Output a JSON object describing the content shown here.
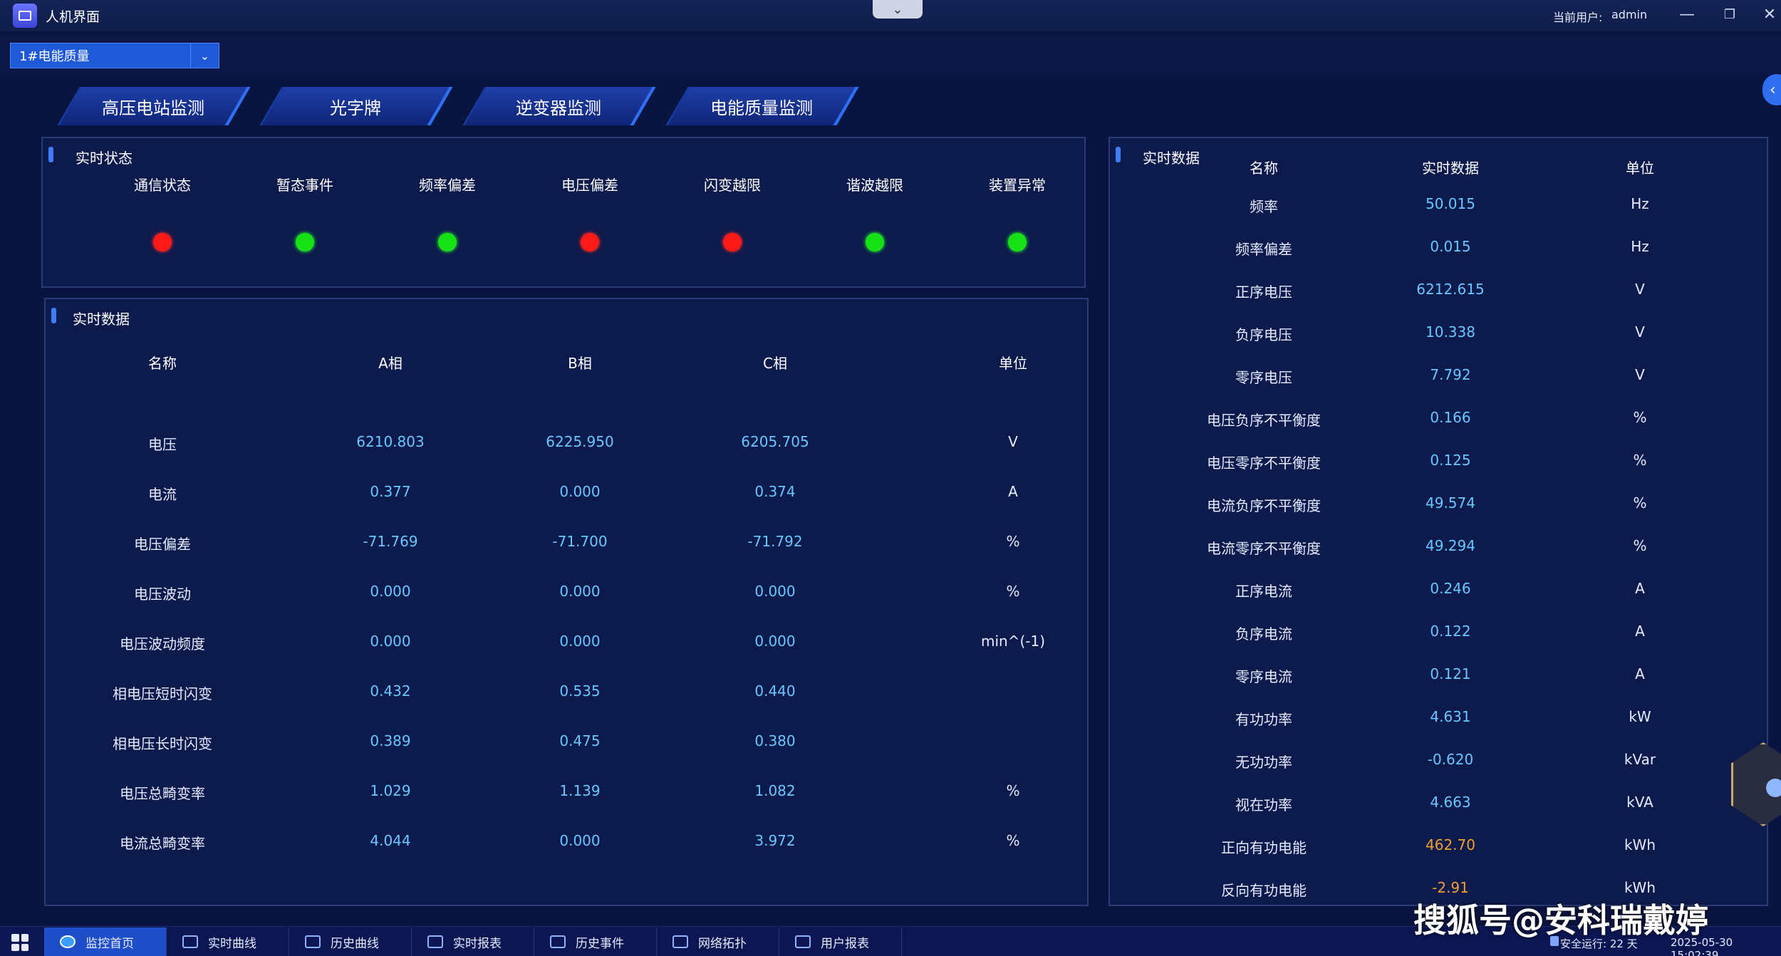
{
  "window": {
    "title": "人机界面",
    "current_user_label": "当前用户:",
    "current_user": "admin",
    "minimize": "—",
    "restore": "❐",
    "close": "✕"
  },
  "device_select": {
    "value": "1#电能质量"
  },
  "tabs": [
    "高压电站监测",
    "光字牌",
    "逆变器监测",
    "电能质量监测"
  ],
  "status_panel": {
    "title": "实时状态",
    "items": [
      {
        "label": "通信状态",
        "state": "red"
      },
      {
        "label": "暂态事件",
        "state": "green"
      },
      {
        "label": "频率偏差",
        "state": "green"
      },
      {
        "label": "电压偏差",
        "state": "red"
      },
      {
        "label": "闪变越限",
        "state": "red"
      },
      {
        "label": "谐波越限",
        "state": "green"
      },
      {
        "label": "装置异常",
        "state": "green"
      }
    ]
  },
  "phase_panel": {
    "title": "实时数据",
    "headers": [
      "名称",
      "A相",
      "B相",
      "C相",
      "单位"
    ],
    "rows": [
      [
        "电压",
        "6210.803",
        "6225.950",
        "6205.705",
        "V"
      ],
      [
        "电流",
        "0.377",
        "0.000",
        "0.374",
        "A"
      ],
      [
        "电压偏差",
        "-71.769",
        "-71.700",
        "-71.792",
        "%"
      ],
      [
        "电压波动",
        "0.000",
        "0.000",
        "0.000",
        "%"
      ],
      [
        "电压波动频度",
        "0.000",
        "0.000",
        "0.000",
        "min^(-1)"
      ],
      [
        "相电压短时闪变",
        "0.432",
        "0.535",
        "0.440",
        ""
      ],
      [
        "相电压长时闪变",
        "0.389",
        "0.475",
        "0.380",
        ""
      ],
      [
        "电压总畸变率",
        "1.029",
        "1.139",
        "1.082",
        "%"
      ],
      [
        "电流总畸变率",
        "4.044",
        "0.000",
        "3.972",
        "%"
      ]
    ]
  },
  "summary_panel": {
    "title": "实时数据",
    "headers": [
      "名称",
      "实时数据",
      "单位"
    ],
    "rows": [
      [
        "频率",
        "50.015",
        "Hz"
      ],
      [
        "频率偏差",
        "0.015",
        "Hz"
      ],
      [
        "正序电压",
        "6212.615",
        "V"
      ],
      [
        "负序电压",
        "10.338",
        "V"
      ],
      [
        "零序电压",
        "7.792",
        "V"
      ],
      [
        "电压负序不平衡度",
        "0.166",
        "%"
      ],
      [
        "电压零序不平衡度",
        "0.125",
        "%"
      ],
      [
        "电流负序不平衡度",
        "49.574",
        "%"
      ],
      [
        "电流零序不平衡度",
        "49.294",
        "%"
      ],
      [
        "正序电流",
        "0.246",
        "A"
      ],
      [
        "负序电流",
        "0.122",
        "A"
      ],
      [
        "零序电流",
        "0.121",
        "A"
      ],
      [
        "有功功率",
        "4.631",
        "kW"
      ],
      [
        "无功功率",
        "-0.620",
        "kVar"
      ],
      [
        "视在功率",
        "4.663",
        "kVA"
      ],
      [
        "正向有功电能",
        "462.70",
        "kWh"
      ],
      [
        "反向有功电能",
        "-2.91",
        "kWh"
      ]
    ]
  },
  "taskbar": {
    "items": [
      "监控首页",
      "实时曲线",
      "历史曲线",
      "实时报表",
      "历史事件",
      "网络拓扑",
      "用户报表"
    ],
    "run_status": "安全运行: 22 天",
    "datetime": "2025-05-30 15:02:39"
  },
  "watermark": "搜狐号@安科瑞戴婷",
  "colors": {
    "accent": "#3f7cff",
    "value": "#67c8ff",
    "energy": "#f0a030",
    "alarm": "#ff1a1a",
    "ok": "#16e216"
  }
}
